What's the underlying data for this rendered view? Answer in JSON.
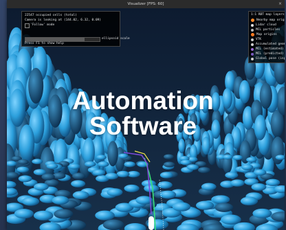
{
  "window": {
    "title": "Visualizer [FPS: 60]",
    "close_glyph": "×"
  },
  "info_panel": {
    "lines": [
      "22547 occupied cells (total)",
      "Camera is looking at (144.02, 6.32, 0.09)",
      "'Follow' mode"
    ],
    "slider_label": "ellipsoid scale",
    "slider_fraction": 0.8,
    "help": "Press F1 to show help"
  },
  "legend": {
    "title": "1:1 RBT map layers",
    "items": [
      {
        "label": "Nearby map origins",
        "color": "#ff8a2a"
      },
      {
        "label": "Lidar cloud",
        "color": "#e0e0e0"
      },
      {
        "label": "MCL particles",
        "color": "#bbbbbb"
      },
      {
        "label": "Map origins",
        "color": "#ff7a20"
      },
      {
        "label": "VTK",
        "color": "#cccccc"
      },
      {
        "label": "Accumulated geometry",
        "color": "#d0d0d0"
      },
      {
        "label": "MCL (estimated)",
        "color": "#9a6bd6"
      },
      {
        "label": "MCL (predicted)",
        "color": "#7a5cc0"
      },
      {
        "label": "Global pose (input)",
        "color": "#cfcfcf"
      }
    ]
  },
  "overlay": {
    "line1": "Automation",
    "line2": "Software"
  },
  "colors": {
    "ellipsoid": "#2aa3e0",
    "trajectory_green": "#39e07a",
    "trajectory_purple": "#7b4ad8"
  }
}
